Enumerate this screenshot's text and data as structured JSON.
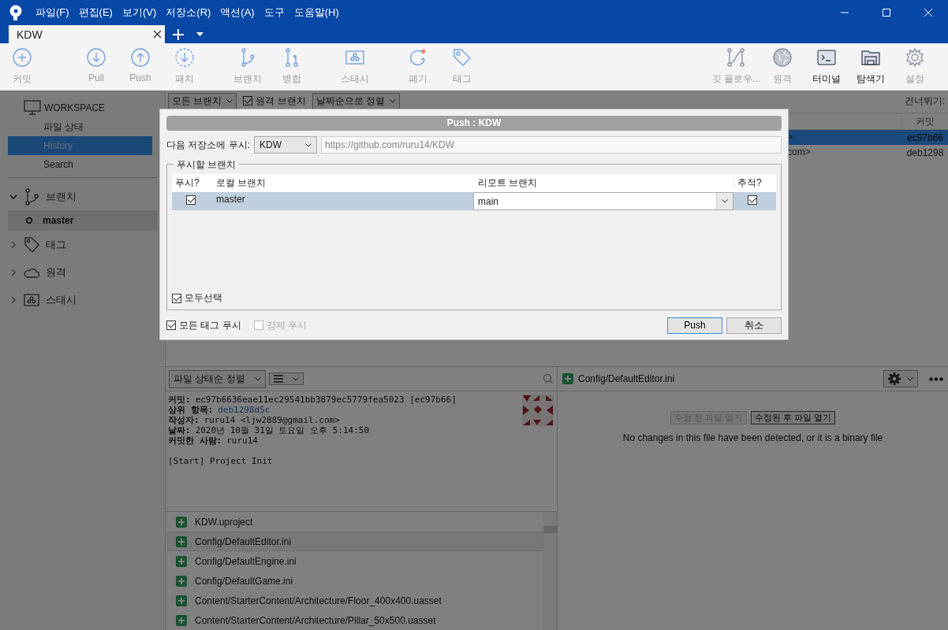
{
  "window": {
    "menus": [
      "파일(F)",
      "편집(E)",
      "보기(V)",
      "저장소(R)",
      "액션(A)",
      "도구",
      "도움말(H)"
    ]
  },
  "tabs": [
    {
      "label": "KDW",
      "selected": true
    }
  ],
  "toolbar": {
    "left_groups": [
      [
        {
          "label": "커밋",
          "kind": "commit",
          "disabled": true
        }
      ],
      [
        {
          "label": "Pull",
          "kind": "pull",
          "disabled": true
        },
        {
          "label": "Push",
          "kind": "push",
          "disabled": true
        },
        {
          "label": "패치",
          "kind": "fetch",
          "disabled": true
        }
      ],
      [
        {
          "label": "브랜치",
          "kind": "branch",
          "disabled": true
        },
        {
          "label": "병합",
          "kind": "merge",
          "disabled": true
        }
      ],
      [
        {
          "label": "스태시",
          "kind": "stash",
          "disabled": true
        }
      ],
      [
        {
          "label": "폐기",
          "kind": "discard",
          "disabled": true
        },
        {
          "label": "태그",
          "kind": "tag",
          "disabled": true
        }
      ]
    ],
    "right": [
      {
        "label": "깃 플로우...",
        "kind": "gitflow",
        "disabled": true
      },
      {
        "label": "원격",
        "kind": "remote",
        "disabled": true
      },
      {
        "label": "터미널",
        "kind": "terminal",
        "disabled": false
      },
      {
        "label": "탐색기",
        "kind": "explorer",
        "disabled": false
      },
      {
        "label": "설정",
        "kind": "settings",
        "disabled": true
      }
    ]
  },
  "sidebar": {
    "workspace": {
      "title": "WORKSPACE",
      "items": [
        {
          "label": "파일 상태",
          "selected": false
        },
        {
          "label": "History",
          "selected": true
        },
        {
          "label": "Search",
          "selected": false
        }
      ]
    },
    "sections": [
      {
        "label": "브랜치",
        "kind": "branch",
        "expanded": true,
        "children": [
          {
            "label": "master",
            "current": true
          }
        ]
      },
      {
        "label": "태그",
        "kind": "tag",
        "expanded": false
      },
      {
        "label": "원격",
        "kind": "remote",
        "expanded": false
      },
      {
        "label": "스태시",
        "kind": "stash",
        "expanded": false
      }
    ]
  },
  "history": {
    "branch_filter": "모든 브랜치",
    "remote_branches": {
      "label": "원격 브랜치",
      "checked": true
    },
    "sort": "날짜순으로 정렬",
    "skip_label": "건너뛰기:",
    "commit_column": "커밋",
    "rows": [
      {
        "author": ">",
        "commit": "ec97b66",
        "selected": true
      },
      {
        "author": "com>",
        "commit": "deb1298",
        "selected": false
      }
    ]
  },
  "details": {
    "sort": "파일 상태순 정렬",
    "fields": [
      {
        "label": "커밋:",
        "value": "ec97b6636eae11ec29541bb3879ec5779fea5023 [ec97b66]",
        "link": false
      },
      {
        "label": "상위 항목:",
        "value": "deb1298d5c",
        "link": true
      },
      {
        "label": "작성자:",
        "value": "ruru14 <ljw2889@gmail.com>",
        "link": false
      },
      {
        "label": "날짜:",
        "value": "2020년 10월 31일 토요일 오후 5:14:50",
        "link": false
      },
      {
        "label": "커밋한 사람:",
        "value": "ruru14",
        "link": false
      }
    ],
    "message": "[Start] Project Init",
    "files": [
      {
        "path": "KDW.uproject",
        "kind": "added",
        "selected": false
      },
      {
        "path": "Config/DefaultEditor.ini",
        "kind": "added",
        "selected": true
      },
      {
        "path": "Config/DefaultEngine.ini",
        "kind": "added",
        "selected": false
      },
      {
        "path": "Config/DefaultGame.ini",
        "kind": "added",
        "selected": false
      },
      {
        "path": "Content/StarterContent/Architecture/Floor_400x400.uasset",
        "kind": "added",
        "selected": false
      },
      {
        "path": "Content/StarterContent/Architecture/Pillar_50x500.uasset",
        "kind": "added",
        "selected": false
      }
    ]
  },
  "diff": {
    "file": "Config/DefaultEditor.ini",
    "kind": "added",
    "buttons": [
      {
        "label": "수정 전 파일 열기",
        "disabled": true
      },
      {
        "label": "수정된 후 파일 열기",
        "disabled": false
      }
    ],
    "message": "No changes in this file have been detected, or it is a binary file"
  },
  "dialog": {
    "title": "Push :  KDW",
    "repo_label": "다음 저장소에 푸시:",
    "repo": "KDW",
    "url": "https://github.com/ruru14/KDW",
    "group": "푸시할 브랜치",
    "columns": [
      "푸시?",
      "로컬 브랜치",
      "리모트 브랜치",
      "추적?"
    ],
    "rows": [
      {
        "push": true,
        "local": "master",
        "remote": "main",
        "track": true,
        "selected": true
      }
    ],
    "select_all": {
      "label": "모두선택",
      "checked": true
    },
    "options": [
      {
        "label": "모든 태그 푸시",
        "checked": true,
        "disabled": false
      },
      {
        "label": "강제 푸시",
        "checked": false,
        "disabled": true
      }
    ],
    "buttons": [
      {
        "label": "Push",
        "default": true
      },
      {
        "label": "취소",
        "default": false
      }
    ]
  }
}
